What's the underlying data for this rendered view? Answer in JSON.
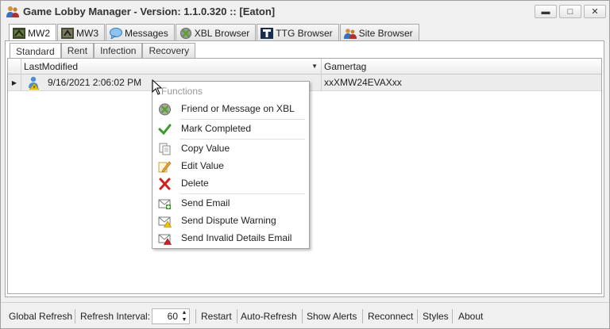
{
  "window": {
    "title": "Game Lobby Manager - Version: 1.1.0.320 :: [Eaton]",
    "app_icon": "users-icon",
    "controls": {
      "minimize": "▬",
      "maximize": "□",
      "close": "✕"
    }
  },
  "main_tabs": [
    {
      "label": "MW2",
      "icon": "mw2-icon",
      "active": true
    },
    {
      "label": "MW3",
      "icon": "mw3-icon",
      "active": false
    },
    {
      "label": "Messages",
      "icon": "speech-bubble-icon",
      "active": false
    },
    {
      "label": "XBL Browser",
      "icon": "xbox-icon",
      "active": false
    },
    {
      "label": "TTG Browser",
      "icon": "ttg-icon",
      "active": false
    },
    {
      "label": "Site Browser",
      "icon": "users-icon",
      "active": false
    }
  ],
  "sub_tabs": [
    {
      "label": "Standard",
      "active": true
    },
    {
      "label": "Rent",
      "active": false
    },
    {
      "label": "Infection",
      "active": false
    },
    {
      "label": "Recovery",
      "active": false
    }
  ],
  "grid": {
    "columns": [
      "LastModified",
      "Gamertag"
    ],
    "sort_indicator": "▼",
    "row_indicator": "▶",
    "rows": [
      {
        "last_modified": "9/16/2021 2:06:02 PM",
        "gamertag": "xxXMW24EVAXxx",
        "icon": "user-warning-icon"
      }
    ]
  },
  "context_menu": {
    "header": "Functions",
    "items": [
      {
        "label": "Friend or Message on XBL",
        "icon": "xbox-icon"
      },
      {
        "label": "Mark Completed",
        "icon": "checkmark-icon"
      },
      {
        "label": "Copy Value",
        "icon": "copy-icon"
      },
      {
        "label": "Edit Value",
        "icon": "edit-icon"
      },
      {
        "label": "Delete",
        "icon": "delete-x-icon"
      },
      {
        "label": "Send Email",
        "icon": "email-add-icon"
      },
      {
        "label": "Send Dispute Warning",
        "icon": "email-warning-icon"
      },
      {
        "label": "Send Invalid Details Email",
        "icon": "email-error-icon"
      }
    ]
  },
  "status_bar": {
    "global_refresh": "Global Refresh",
    "refresh_interval_label": "Refresh Interval:",
    "refresh_interval_value": "60",
    "restart": "Restart",
    "auto_refresh": "Auto-Refresh",
    "show_alerts": "Show Alerts",
    "reconnect": "Reconnect",
    "styles": "Styles",
    "about": "About"
  },
  "colors": {
    "accent_green": "#3a9a2a",
    "delete_red": "#d02020",
    "xbox_green": "#5aa02a",
    "user_blue": "#4a8fd8",
    "warning_yellow": "#f2c200"
  }
}
